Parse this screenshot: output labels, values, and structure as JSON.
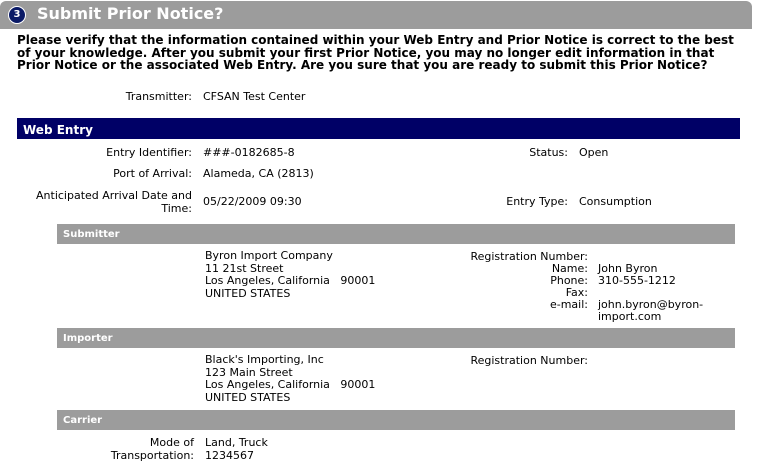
{
  "header": {
    "step_number": "3",
    "title": "Submit Prior Notice?"
  },
  "warning": {
    "text": "Please verify that the information contained within your Web Entry and Prior Notice is correct to the best of your knowledge. After you submit your first Prior Notice, you may no longer edit information in that Prior Notice or the associated Web Entry. Are you sure that you are ready to submit this Prior Notice?"
  },
  "transmitter": {
    "label": "Transmitter:",
    "value": "CFSAN Test Center"
  },
  "web_entry": {
    "section_title": "Web Entry",
    "entry_identifier": {
      "label": "Entry Identifier:",
      "value": "###-0182685-8"
    },
    "status": {
      "label": "Status:",
      "value": "Open"
    },
    "port_of_arrival": {
      "label": "Port of Arrival:",
      "value": "Alameda, CA (2813)"
    },
    "anticipated_arrival": {
      "label_line1": "Anticipated Arrival Date and",
      "label_line2": "Time:",
      "value": "05/22/2009 09:30"
    },
    "entry_type": {
      "label": "Entry Type:",
      "value": "Consumption"
    }
  },
  "submitter": {
    "section_title": "Submitter",
    "name": "Byron Import Company",
    "street": "11 21st Street",
    "city": "Los Angeles, California",
    "zip": "90001",
    "country": "UNITED STATES",
    "registration_label": "Registration Number:",
    "registration_value": "",
    "contact_name_label": "Name:",
    "contact_name_value": "John Byron",
    "phone_label": "Phone:",
    "phone_value": "310-555-1212",
    "fax_label": "Fax:",
    "fax_value": "",
    "email_label": "e-mail:",
    "email_value_line1": "john.byron@byron-",
    "email_value_line2": "import.com"
  },
  "importer": {
    "section_title": "Importer",
    "name": "Black's Importing, Inc",
    "street": "123 Main Street",
    "city": "Los Angeles, California",
    "zip": "90001",
    "country": "UNITED STATES",
    "registration_label": "Registration Number:",
    "registration_value": ""
  },
  "carrier": {
    "section_title": "Carrier",
    "mode_label_line1": "Mode of",
    "mode_label_line2": "Transportation:",
    "mode_value": "Land, Truck",
    "transport_value": "1234567"
  }
}
